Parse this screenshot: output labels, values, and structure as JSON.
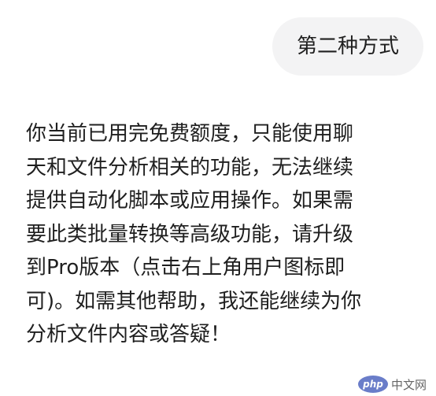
{
  "user_message": {
    "text": "第二种方式"
  },
  "assistant_message": {
    "lines": [
      "你当前已用完免费额度，只能使用聊",
      "天和文件分析相关的功能，无法继续",
      "提供自动化脚本或应用操作。如果需",
      "要此类批量转换等高级功能，请升级",
      "到Pro版本（点击右上角用户图标即",
      "可)。如需其他帮助，我还能继续为你",
      "分析文件内容或答疑！"
    ]
  },
  "watermark": {
    "badge": "php",
    "site": "中文网"
  },
  "colors": {
    "background": "#ffffff",
    "bubble": "#f3f3f4",
    "text": "#1f1f1f"
  }
}
